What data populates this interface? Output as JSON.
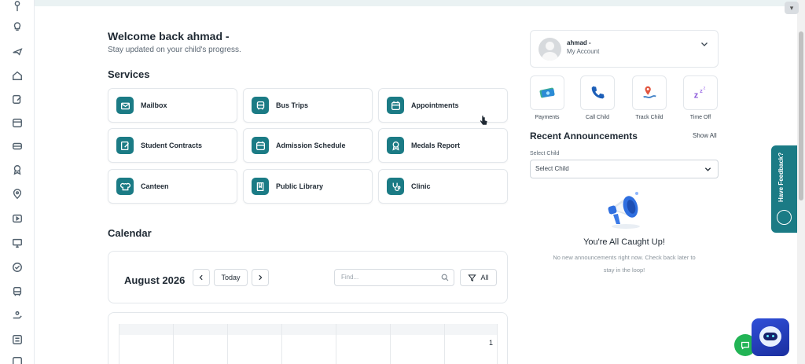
{
  "welcome": {
    "title": "Welcome back ahmad -",
    "subtitle": "Stay updated on your child's progress."
  },
  "services": {
    "title": "Services",
    "items": [
      {
        "label": "Mailbox",
        "icon": "mail-icon"
      },
      {
        "label": "Bus Trips",
        "icon": "bus-icon"
      },
      {
        "label": "Appointments",
        "icon": "calendar-icon"
      },
      {
        "label": "Student Contracts",
        "icon": "contract-icon"
      },
      {
        "label": "Admission Schedule",
        "icon": "calendar-icon"
      },
      {
        "label": "Medals Report",
        "icon": "medal-icon"
      },
      {
        "label": "Canteen",
        "icon": "chef-hat-icon"
      },
      {
        "label": "Public Library",
        "icon": "book-icon"
      },
      {
        "label": "Clinic",
        "icon": "stethoscope-icon"
      }
    ]
  },
  "calendar": {
    "title": "Calendar",
    "month": "August 2026",
    "today_label": "Today",
    "search_placeholder": "Find...",
    "filter_label": "All",
    "first_date": "1"
  },
  "account": {
    "name": "ahmad -",
    "subtitle": "My Account"
  },
  "quick_actions": [
    {
      "label": "Payments",
      "icon": "money-icon"
    },
    {
      "label": "Call Child",
      "icon": "phone-icon"
    },
    {
      "label": "Track Child",
      "icon": "location-pin-icon"
    },
    {
      "label": "Time Off",
      "icon": "sleep-icon"
    }
  ],
  "announcements": {
    "title": "Recent Announcements",
    "show_all": "Show All",
    "select_label": "Select Child",
    "select_value": "Select Child",
    "empty_title": "You're All Caught Up!",
    "empty_text": "No new announcements right now. Check back later to stay in the loop!"
  },
  "feedback": {
    "label": "Have Feedback?"
  },
  "colors": {
    "accent": "#1b7b85",
    "chat_green": "#22b455",
    "bot_blue": "#2f4fd8"
  }
}
